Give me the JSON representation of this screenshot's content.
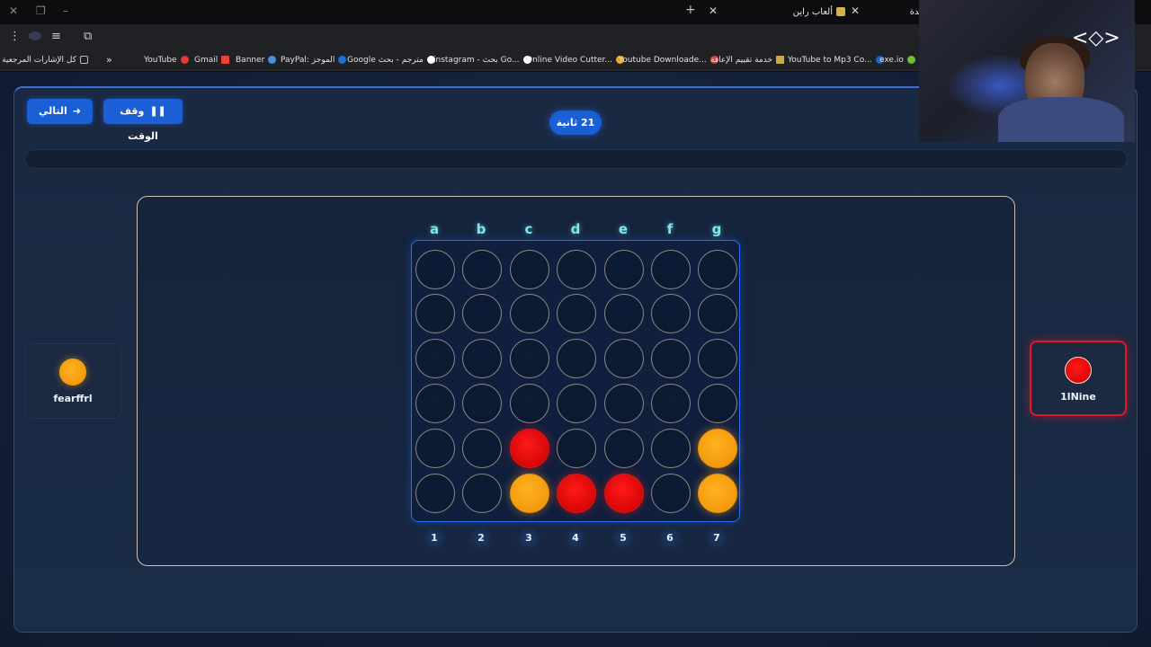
{
  "browser": {
    "tabs": [
      {
        "title": "ألعاب راين"
      },
      {
        "title": "يدة"
      }
    ],
    "window_controls": {
      "close": "✕",
      "maximize": "❐",
      "minimize": "–"
    },
    "bookmarks": [
      {
        "label": "كل الإشارات المرجعية",
        "icon": "folder-icon"
      },
      {
        "label": "YouTube",
        "icon": "youtube-icon",
        "color": "#e53935"
      },
      {
        "label": "Gmail",
        "icon": "gmail-icon",
        "color": "#ea4335"
      },
      {
        "label": "Banner",
        "icon": "banner-icon",
        "color": "#4a90d9"
      },
      {
        "label": "PayPal: الموجز",
        "icon": "paypal-icon",
        "color": "#1f6fd1"
      },
      {
        "label": "Google مترجم - بحث",
        "icon": "google-icon",
        "color": "#ffffff"
      },
      {
        "label": "instagram - بحث Go...",
        "icon": "google-icon",
        "color": "#ffffff"
      },
      {
        "label": "Online Video Cutter...",
        "icon": "cutter-icon",
        "color": "#f5a623"
      },
      {
        "label": "Youtube Downloade...",
        "icon": "downloader-icon",
        "color": "#e53935"
      },
      {
        "label": "خدمة تقييم الإعاقة",
        "icon": "palm-icon",
        "color": "#c9a74a"
      },
      {
        "label": "YouTube to Mp3 Co...",
        "icon": "mp3-icon",
        "color": "#1e63c6"
      },
      {
        "label": "exe.io",
        "icon": "exe-icon",
        "color": "#6cbf3a"
      }
    ]
  },
  "game": {
    "next_button": "التالي",
    "pause_button": "وقف الوقت",
    "timer": "21 ثانية",
    "columns": [
      "a",
      "b",
      "c",
      "d",
      "e",
      "f",
      "g"
    ],
    "column_numbers": [
      "1",
      "2",
      "3",
      "4",
      "5",
      "6",
      "7"
    ],
    "board": [
      [
        "empty",
        "empty",
        "empty",
        "empty",
        "empty",
        "empty",
        "empty"
      ],
      [
        "empty",
        "empty",
        "empty",
        "empty",
        "empty",
        "empty",
        "empty"
      ],
      [
        "empty",
        "empty",
        "empty",
        "empty",
        "empty",
        "empty",
        "empty"
      ],
      [
        "empty",
        "empty",
        "empty",
        "empty",
        "empty",
        "empty",
        "empty"
      ],
      [
        "empty",
        "empty",
        "red",
        "empty",
        "empty",
        "empty",
        "yellow"
      ],
      [
        "empty",
        "empty",
        "yellow",
        "red",
        "red",
        "empty",
        "yellow"
      ]
    ],
    "players": {
      "left": {
        "name": "fearffrl",
        "disc": "yellow"
      },
      "right": {
        "name": "1lNine",
        "disc": "red",
        "active": true
      }
    },
    "colors": {
      "red": "#d80606",
      "yellow": "#f39a0c",
      "accent": "#1a5fd6"
    }
  }
}
